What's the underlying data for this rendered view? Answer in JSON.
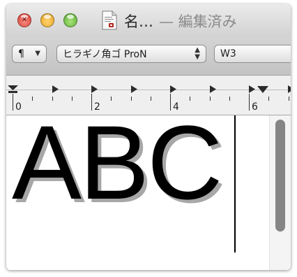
{
  "window": {
    "title": "名…",
    "status": " — 編集済み"
  },
  "toolbar": {
    "paragraph_button": "¶",
    "font_family": "ヒラギノ角ゴ ProN",
    "font_weight": "W3"
  },
  "ruler": {
    "labels": [
      "0",
      "2",
      "4",
      "6"
    ]
  },
  "document": {
    "text": "ABC"
  },
  "colors": {
    "close": "#d6342b",
    "minimize": "#e39c19",
    "zoom": "#4fa52a",
    "text_shadow": "#a7a7a7"
  },
  "icons": [
    "close-icon",
    "minimize-icon",
    "zoom-icon",
    "document-icon",
    "chevron-down-icon",
    "stepper-icon",
    "tab-stop-icon"
  ]
}
